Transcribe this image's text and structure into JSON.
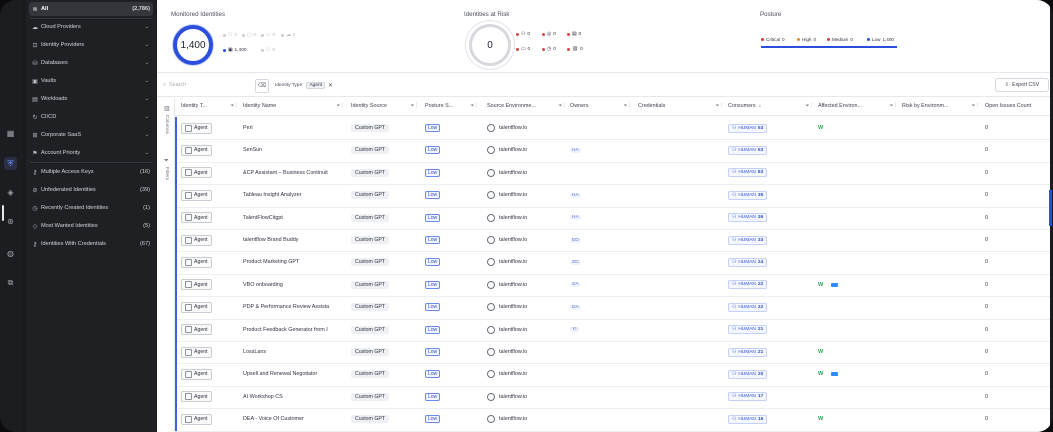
{
  "rail_icons": [
    "grid-icon",
    "shield-icon",
    "diamond-icon",
    "user-check-icon",
    "globe-icon",
    "link-icon"
  ],
  "sidebar": {
    "items": [
      {
        "label": "All",
        "count": "(2,786)",
        "icon": "layers-icon",
        "active": true
      },
      {
        "label": "Cloud Providers",
        "chev": "⌄",
        "icon": "cloud-icon"
      },
      {
        "label": "Identity Providers",
        "chev": "⌄",
        "icon": "id-icon"
      },
      {
        "label": "Databases",
        "chev": "⌄",
        "icon": "database-icon"
      },
      {
        "label": "Vaults",
        "chev": "⌄",
        "icon": "vault-icon"
      },
      {
        "label": "Workloads",
        "chev": "⌄",
        "icon": "workload-icon"
      },
      {
        "label": "CI/CD",
        "chev": "⌄",
        "icon": "cicd-icon"
      },
      {
        "label": "Corporate SaaS",
        "chev": "⌄",
        "icon": "saas-icon"
      },
      {
        "label": "Account Priority",
        "chev": "⌄",
        "icon": "priority-icon"
      },
      {
        "label": "Multiple Access Keys",
        "count": "(16)",
        "icon": "key-icon"
      },
      {
        "label": "Unfederated Identities",
        "count": "(39)",
        "icon": "unlink-icon"
      },
      {
        "label": "Recently Created Identities",
        "count": "(1)",
        "icon": "clock-icon"
      },
      {
        "label": "Most Wanted Identities",
        "count": "(5)",
        "icon": "diamond-icon"
      },
      {
        "label": "Identities With Credentials",
        "count": "(67)",
        "icon": "key-icon"
      }
    ]
  },
  "summary": {
    "monitored_title": "Monitored Identities",
    "monitored_value": "1,400",
    "monitored_minis": [
      {
        "icon": "person-icon",
        "val": "0",
        "dark": false
      },
      {
        "icon": "box-icon",
        "val": "0",
        "dark": false
      },
      {
        "icon": "monitor-icon",
        "val": "0",
        "dark": false
      },
      {
        "icon": "cloud-icon",
        "val": "0",
        "dark": false
      },
      {
        "icon": "bot-icon",
        "val": "1,400",
        "dark": true
      },
      {
        "icon": "user-icon",
        "val": "0",
        "dark": false
      }
    ],
    "risk_title": "Identities at Risk",
    "risk_value": "0",
    "risk_minis": [
      {
        "icon": "people-icon",
        "val": "0"
      },
      {
        "icon": "circle-icon",
        "val": "0"
      },
      {
        "icon": "doc-icon",
        "val": "0"
      },
      {
        "icon": "chat-icon",
        "val": "0"
      },
      {
        "icon": "clock-icon",
        "val": "0"
      },
      {
        "icon": "link-icon",
        "val": "0"
      }
    ],
    "posture_title": "Posture",
    "posture_items": [
      {
        "label": "Critical",
        "val": "0",
        "color": "#d93b3b"
      },
      {
        "label": "High",
        "val": "0",
        "color": "#e0892f"
      },
      {
        "label": "Medium",
        "val": "0",
        "color": "#d04040"
      },
      {
        "label": "Low",
        "val": "1,400",
        "color": "#2b4fdc"
      }
    ]
  },
  "toolbar": {
    "search_placeholder": "Search",
    "filter_label": "Identity Type:",
    "filter_value": "Agent",
    "export_label": "Export CSV"
  },
  "side_tabs": {
    "columns": "Columns",
    "filters": "Filters"
  },
  "table": {
    "headers": [
      "Identity T...",
      "Identity Name",
      "Identity Source",
      "Posture S...",
      "Source Environme...",
      "Owners",
      "Credentials",
      "Consumers",
      "Affected Environ...",
      "Risk by Environm...",
      "Open Issues Count"
    ],
    "rows": [
      {
        "type": "Agent",
        "name": "Perl",
        "source": "Custom GPT",
        "posture": "Low",
        "env": "talentflow.io",
        "owner": "",
        "consumers": "53",
        "envicons": "w"
      },
      {
        "type": "Agent",
        "name": "SenSun",
        "source": "Custom GPT",
        "posture": "Low",
        "env": "talentflow.io",
        "owner": "HA",
        "consumers": "53",
        "envicons": ""
      },
      {
        "type": "Agent",
        "name": "&CP Assistant – Business Continuit",
        "source": "Custom GPT",
        "posture": "Low",
        "env": "talentflow.io",
        "owner": "",
        "consumers": "83",
        "envicons": ""
      },
      {
        "type": "Agent",
        "name": "Tableau Insight Analyzer",
        "source": "Custom GPT",
        "posture": "Low",
        "env": "talentflow.io",
        "owner": "HA",
        "consumers": "35",
        "envicons": ""
      },
      {
        "type": "Agent",
        "name": "TalentFlowCitgpt",
        "source": "Custom GPT",
        "posture": "Low",
        "env": "talentflow.io",
        "owner": "HA",
        "consumers": "36",
        "envicons": ""
      },
      {
        "type": "Agent",
        "name": "talentflow Brand Buddy",
        "source": "Custom GPT",
        "posture": "Low",
        "env": "talentflow.io",
        "owner": "ED",
        "consumers": "33",
        "envicons": ""
      },
      {
        "type": "Agent",
        "name": "Product Marketing GPT",
        "source": "Custom GPT",
        "posture": "Low",
        "env": "talentflow.io",
        "owner": "ZO",
        "consumers": "24",
        "envicons": ""
      },
      {
        "type": "Agent",
        "name": "VBO onboarding",
        "source": "Custom GPT",
        "posture": "Low",
        "env": "talentflow.io",
        "owner": "SA",
        "consumers": "22",
        "envicons": "wz"
      },
      {
        "type": "Agent",
        "name": "PDP & Performance Review Assista",
        "source": "Custom GPT",
        "posture": "Low",
        "env": "talentflow.io",
        "owner": "DA",
        "consumers": "22",
        "envicons": ""
      },
      {
        "type": "Agent",
        "name": "Product Feedback Generator from I",
        "source": "Custom GPT",
        "posture": "Low",
        "env": "talentflow.io",
        "owner": "YI",
        "consumers": "21",
        "envicons": ""
      },
      {
        "type": "Agent",
        "name": "LossLans",
        "source": "Custom GPT",
        "posture": "Low",
        "env": "talentflow.io",
        "owner": "",
        "consumers": "21",
        "envicons": "w"
      },
      {
        "type": "Agent",
        "name": "Upsell and Renewal Negotiator",
        "source": "Custom GPT",
        "posture": "Low",
        "env": "talentflow.io",
        "owner": "",
        "consumers": "20",
        "envicons": "wz"
      },
      {
        "type": "Agent",
        "name": "AI Workshop CS",
        "source": "Custom GPT",
        "posture": "Low",
        "env": "talentflow.io",
        "owner": "",
        "consumers": "17",
        "envicons": ""
      },
      {
        "type": "Agent",
        "name": "DEA - Voice Of Customer",
        "source": "Custom GPT",
        "posture": "Low",
        "env": "talentflow.io",
        "owner": "",
        "consumers": "16",
        "envicons": "w"
      }
    ],
    "open_issues": "0",
    "human_label": "HUMAN"
  }
}
